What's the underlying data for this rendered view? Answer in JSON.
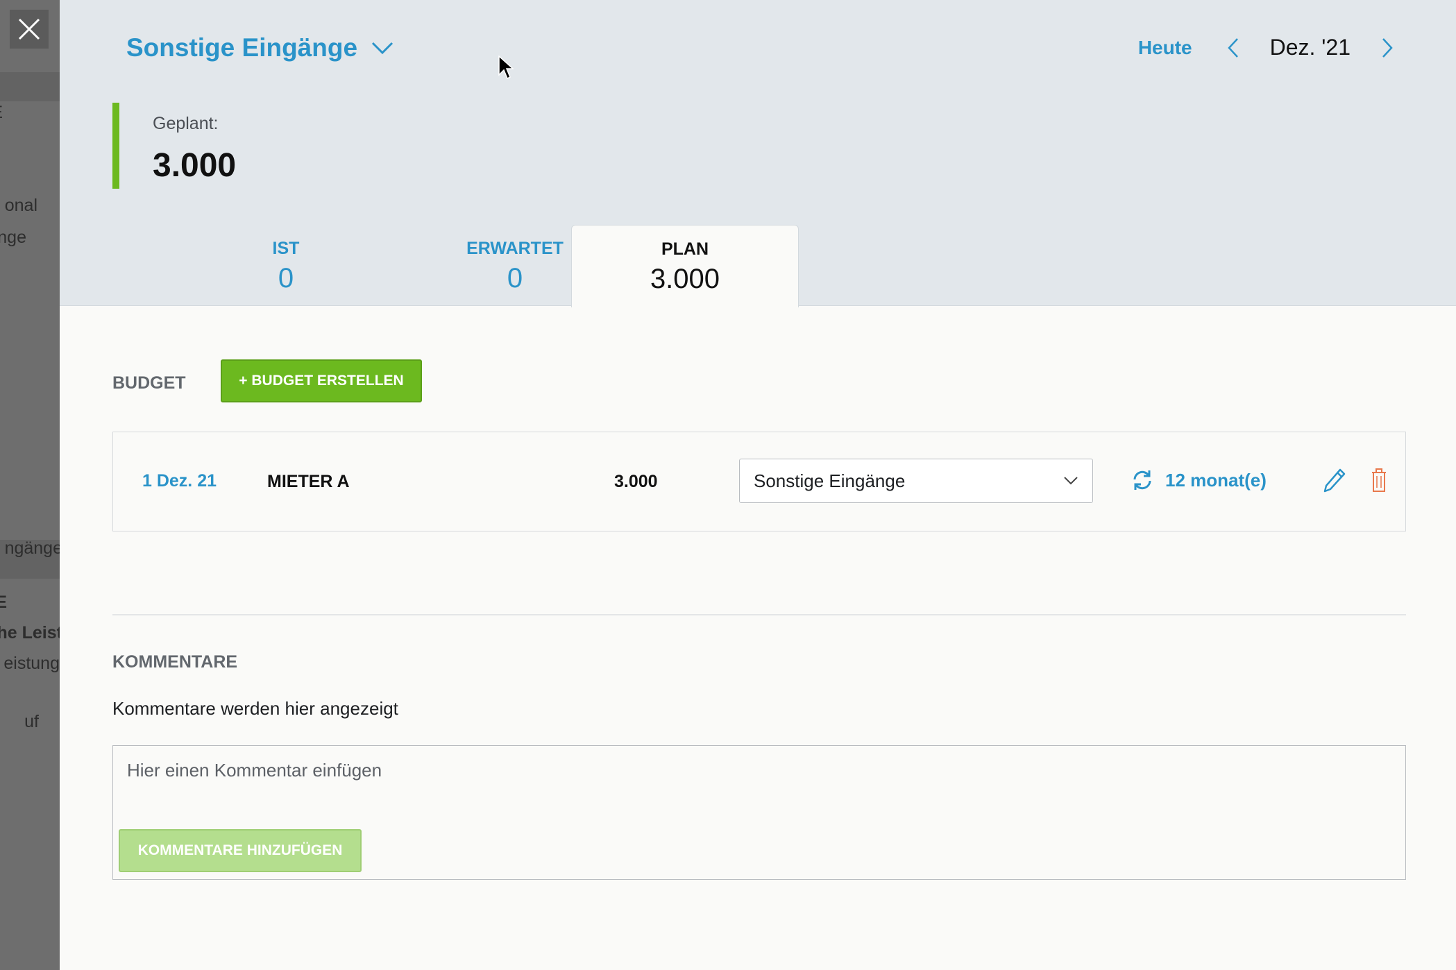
{
  "left_panel": {
    "fragments": [
      "E",
      "onal",
      "nge",
      "ngänge",
      "E",
      "he Leist",
      "eistung",
      "uf"
    ]
  },
  "header": {
    "title": "Sonstige Eingänge",
    "today_label": "Heute",
    "current_month": "Dez. '21",
    "planned_label": "Geplant:",
    "planned_value": "3.000",
    "accent_color": "#2a93c9",
    "green_color": "#6cb91f"
  },
  "tabs": [
    {
      "label": "IST",
      "value": "0"
    },
    {
      "label": "ERWARTET",
      "value": "0"
    },
    {
      "label": "PLAN",
      "value": "3.000"
    }
  ],
  "budget": {
    "section_label": "BUDGET",
    "create_button": "+ BUDGET ERSTELLEN",
    "rows": [
      {
        "date": "1 Dez. 21",
        "name": "MIETER A",
        "amount": "3.000",
        "category": "Sonstige Eingänge",
        "recurrence": "12 monat(e)"
      }
    ]
  },
  "comments": {
    "section_label": "KOMMENTARE",
    "empty_text": "Kommentare werden hier angezeigt",
    "placeholder": "Hier einen Kommentar einfügen",
    "add_button": "KOMMENTARE HINZUFÜGEN"
  }
}
